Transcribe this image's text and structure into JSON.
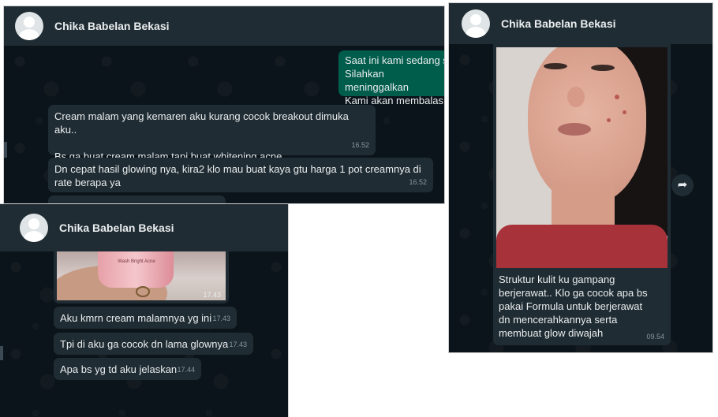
{
  "panel_a": {
    "contact_name": "Chika Babelan Bekasi",
    "outgoing_lines": [
      "Saat ini kami sedang s",
      "Silahkan meninggalkan",
      "Kami akan membalas p"
    ],
    "messages": [
      {
        "text": "Cream malam yang kemaren aku kurang cocok breakout dimuka aku..\n\nBs ga buat cream malam tapi buat whitening acne..",
        "time": "16.52"
      },
      {
        "text": "Dn cepat hasil glowing nya, kira2 klo mau buat kaya gtu harga 1 pot creamnya di rate berapa ya",
        "time": "16.52"
      }
    ]
  },
  "panel_b": {
    "contact_name": "Chika Babelan Bekasi",
    "image_time": "17.43",
    "product_label": "Wash Bright Acne",
    "messages": [
      {
        "text": "Aku kmrn cream malamnya yg ini",
        "time": "17.43"
      },
      {
        "text": "Tpi di aku ga cocok dn lama glownya",
        "time": "17.43"
      },
      {
        "text": "Apa bs yg td aku jelaskan",
        "time": "17.44"
      }
    ]
  },
  "panel_c": {
    "contact_name": "Chika Babelan Bekasi",
    "caption": "Struktur kulit ku gampang berjerawat.. Klo ga cocok apa bs pakai Formula untuk berjerawat dn mencerahkannya serta membuat glow diwajah",
    "time": "09.54",
    "forward_icon": "forward-arrow-icon"
  }
}
